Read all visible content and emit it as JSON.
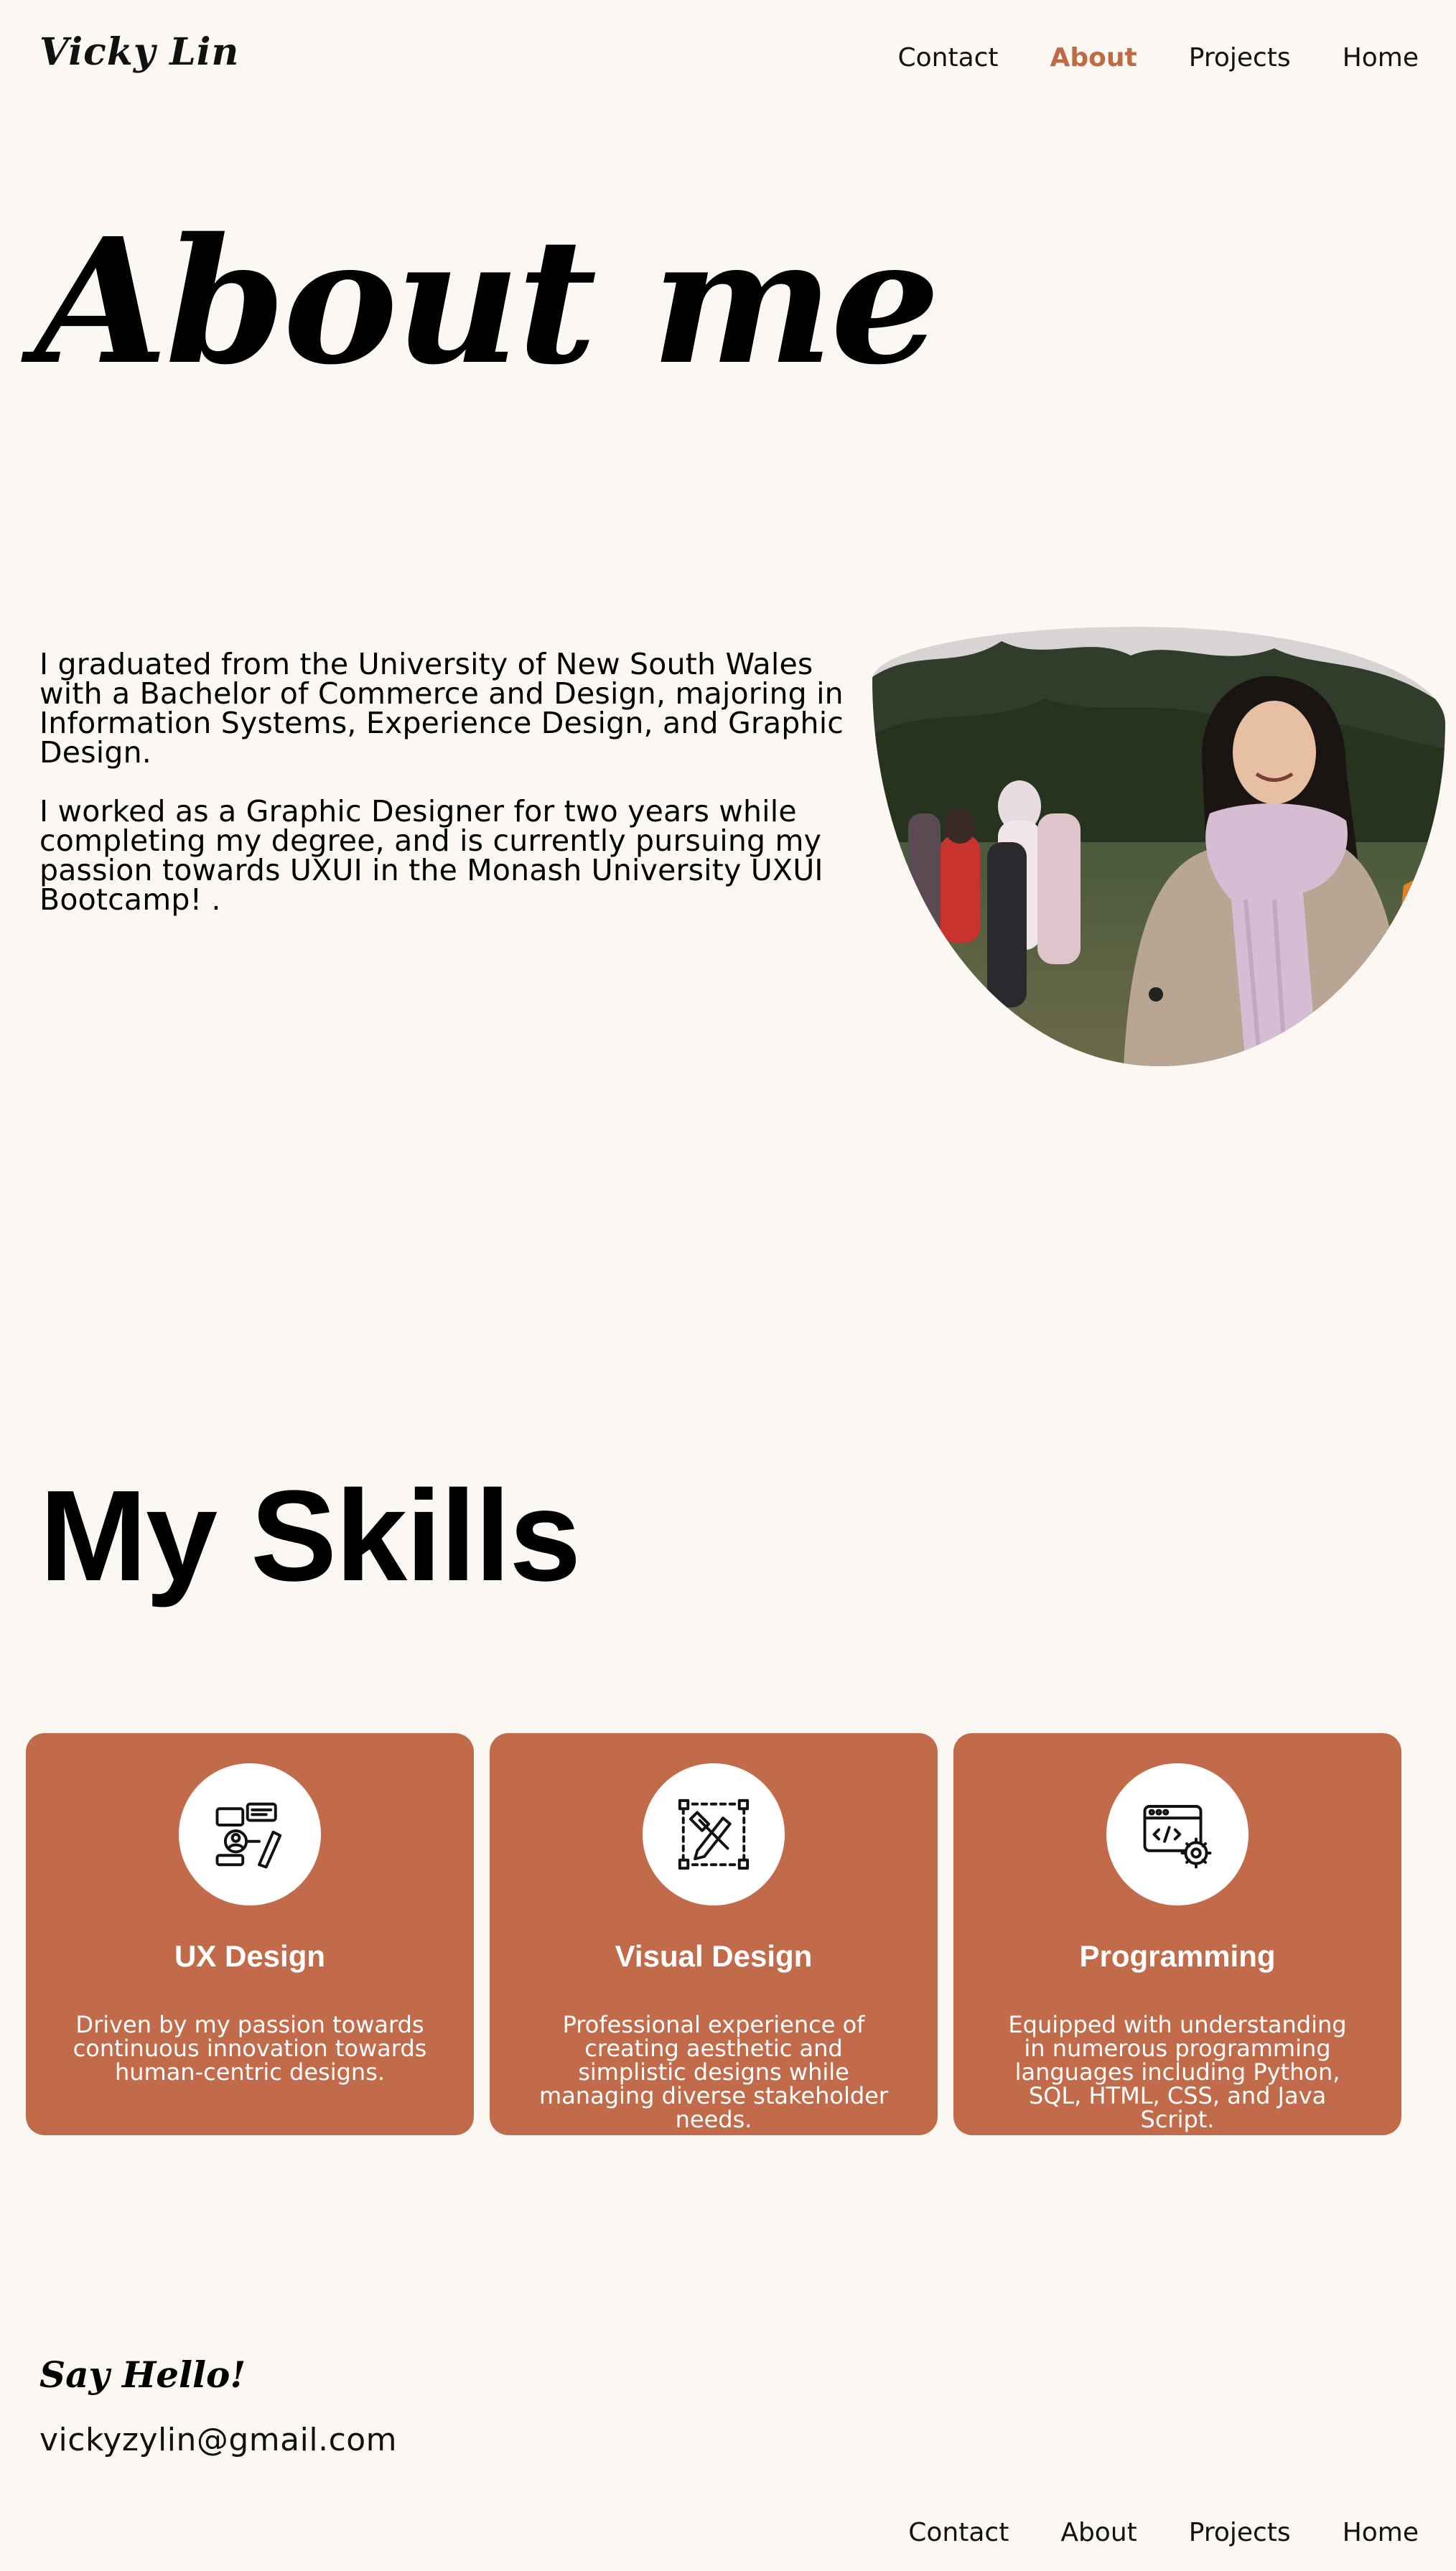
{
  "header": {
    "logo": "Vicky Lin",
    "nav": [
      {
        "label": "Contact",
        "active": false
      },
      {
        "label": "About",
        "active": true
      },
      {
        "label": "Projects",
        "active": false
      },
      {
        "label": "Home",
        "active": false
      }
    ]
  },
  "hero": {
    "title": "About me",
    "bio_paragraphs": [
      "I graduated from the University of New South Wales with a Bachelor of Commerce and Design, majoring in Information Systems, Experience Design, and Graphic Design.",
      "I worked as a Graphic Designer for two years while completing my degree, and is currently pursuing my passion towards UXUI in the Monash University UXUI Bootcamp! ."
    ]
  },
  "skills": {
    "title": "My Skills",
    "cards": [
      {
        "icon": "ux-design-icon",
        "title": "UX Design",
        "description": "Driven by my passion towards continuous innovation towards human-centric designs."
      },
      {
        "icon": "visual-design-icon",
        "title": "Visual Design",
        "description": "Professional experience of creating aesthetic and simplistic designs while managing diverse stakeholder needs."
      },
      {
        "icon": "programming-icon",
        "title": "Programming",
        "description": "Equipped with understanding in numerous programming languages including Python, SQL, HTML, CSS, and Java Script."
      }
    ]
  },
  "footer": {
    "say_hello": "Say Hello!",
    "email": "vickyzylin@gmail.com",
    "nav": [
      {
        "label": "Contact"
      },
      {
        "label": "About"
      },
      {
        "label": "Projects"
      },
      {
        "label": "Home"
      }
    ]
  },
  "colors": {
    "background": "#fbf8f3",
    "accent": "#c26b4b",
    "nav_active": "#c06a45",
    "text": "#000000"
  }
}
